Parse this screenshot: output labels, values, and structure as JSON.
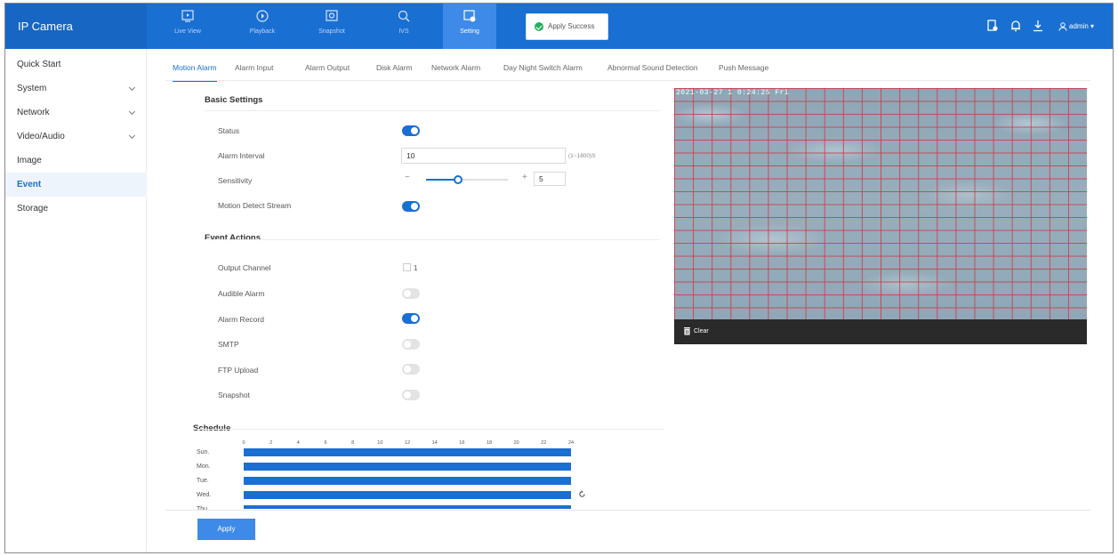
{
  "app": {
    "title": "IP Camera"
  },
  "nav": [
    {
      "label": "Live View",
      "icon": "live-view-icon"
    },
    {
      "label": "Playback",
      "icon": "playback-icon"
    },
    {
      "label": "Snapshot",
      "icon": "snapshot-icon"
    },
    {
      "label": "IVS",
      "icon": "ivs-icon"
    },
    {
      "label": "Setting",
      "icon": "setting-icon"
    }
  ],
  "toast": {
    "text": "Apply Success"
  },
  "header": {
    "user": "admin"
  },
  "sidebar": {
    "items": [
      {
        "label": "Quick Start"
      },
      {
        "label": "System"
      },
      {
        "label": "Network"
      },
      {
        "label": "Video/Audio"
      },
      {
        "label": "Image"
      },
      {
        "label": "Event"
      },
      {
        "label": "Storage"
      }
    ]
  },
  "tabs": [
    "Motion Alarm",
    "Alarm Input",
    "Alarm Output",
    "Disk Alarm",
    "Network Alarm",
    "Day Night Switch Alarm",
    "Abnormal Sound Detection",
    "Push Message"
  ],
  "basic": {
    "title": "Basic Settings",
    "status_label": "Status",
    "interval_label": "Alarm Interval",
    "interval_value": "10",
    "interval_hint": "(1~1800)S",
    "sensitivity_label": "Sensitivity",
    "sensitivity_value": "5",
    "sensitivity_level": 0.4,
    "minus": "−",
    "plus": "+",
    "stream_label": "Motion Detect Stream"
  },
  "actions": {
    "title": "Event Actions",
    "output_label": "Output Channel",
    "output_value": "1",
    "audible_label": "Audible Alarm",
    "record_label": "Alarm Record",
    "smtp_label": "SMTP",
    "ftp_label": "FTP Upload",
    "snapshot_label": "Snapshot"
  },
  "schedule": {
    "title": "Schedule",
    "hours": [
      "0",
      "2",
      "4",
      "6",
      "8",
      "10",
      "12",
      "14",
      "16",
      "18",
      "20",
      "22",
      "24"
    ],
    "days": [
      "Sun.",
      "Mon.",
      "Tue.",
      "Wed.",
      "Thu."
    ]
  },
  "video": {
    "timestamp": "2021-03-27 1 0:24:25 Fri",
    "clear_label": "Clear"
  },
  "footer": {
    "apply_label": "Apply"
  },
  "colors": {
    "accent": "#1a6fd2",
    "topbar": "#1a6fd2",
    "grid": "#cd3c46"
  }
}
